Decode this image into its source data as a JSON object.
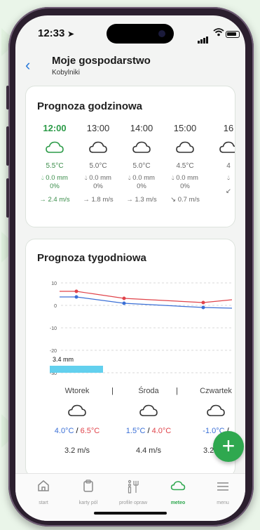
{
  "status_bar": {
    "time": "12:33"
  },
  "header": {
    "back_label": "‹",
    "title": "Moje gospodarstwo",
    "subtitle": "Kobylniki"
  },
  "hourly": {
    "title": "Prognoza godzinowa",
    "items": [
      {
        "time": "12:00",
        "icon": "cloud-icon",
        "temp": "5.5°C",
        "rain": "0.0 mm",
        "chance": "0%",
        "wind": "→ 2.4 m/s",
        "active": true
      },
      {
        "time": "13:00",
        "icon": "cloud-icon",
        "temp": "5.0°C",
        "rain": "0.0 mm",
        "chance": "0%",
        "wind": "→ 1.8 m/s"
      },
      {
        "time": "14:00",
        "icon": "cloud-icon",
        "temp": "5.0°C",
        "rain": "0.0 mm",
        "chance": "0%",
        "wind": "→ 1.3 m/s"
      },
      {
        "time": "15:00",
        "icon": "cloud-icon",
        "temp": "4.5°C",
        "rain": "0.0 mm",
        "chance": "0%",
        "wind": "↘ 0.7 m/s"
      },
      {
        "time": "16",
        "icon": "cloud-icon",
        "temp": "4",
        "rain": "",
        "chance": "",
        "wind": "↙"
      }
    ]
  },
  "weekly": {
    "title": "Prognoza tygodniowa",
    "chart": {
      "y_ticks": [
        "10",
        "0",
        "-10",
        "-20",
        "-30"
      ],
      "rain_label": "3.4 mm",
      "colors": {
        "max": "#e0434a",
        "min": "#3a6fd6",
        "rain": "#62d0ee"
      }
    },
    "days": [
      {
        "name": "Wtorek",
        "min": "4.0°C",
        "max": "6.5°C",
        "wind": "3.2 m/s"
      },
      {
        "name": "Środa",
        "min": "1.5°C",
        "max": "4.0°C",
        "wind": "4.4 m/s"
      },
      {
        "name": "Czwartek",
        "min": "-1.0°C",
        "max": "",
        "wind": "3.2 m/s"
      }
    ],
    "separator": "|",
    "slash": "/"
  },
  "fab": {
    "label": "+"
  },
  "tabbar": {
    "items": [
      {
        "label": "start",
        "icon": "home-icon"
      },
      {
        "label": "karty pól",
        "icon": "clipboard-icon"
      },
      {
        "label": "profile opraw",
        "icon": "sprayer-icon"
      },
      {
        "label": "meteo",
        "icon": "cloud-icon",
        "active": true
      },
      {
        "label": "menu",
        "icon": "menu-icon"
      }
    ]
  },
  "accent": "#2fa84f"
}
